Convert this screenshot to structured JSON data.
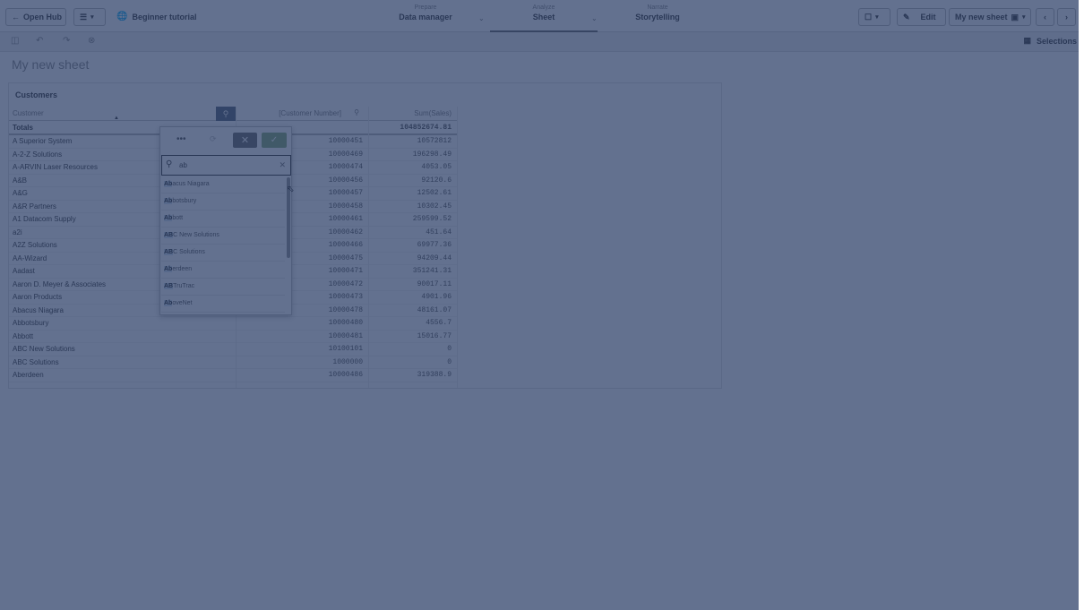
{
  "topbar": {
    "open_hub": "Open Hub",
    "app_name": "Beginner tutorial",
    "tabs": [
      {
        "small": "Prepare",
        "big": "Data manager"
      },
      {
        "small": "Analyze",
        "big": "Sheet"
      },
      {
        "small": "Narrate",
        "big": "Storytelling"
      }
    ],
    "edit_label": "Edit",
    "sheet_selector": "My new sheet"
  },
  "toolbar": {
    "selections_label": "Selections"
  },
  "sheet": {
    "title": "My new sheet"
  },
  "table": {
    "title": "Customers",
    "headers": [
      "Customer",
      "[Customer Number]",
      "Sum(Sales)"
    ],
    "totals": {
      "label": "Totals",
      "sum": "104852674.81"
    },
    "rows": [
      {
        "customer": "A Superior System",
        "number": "10000451",
        "sales": "10572812"
      },
      {
        "customer": "A-2-Z Solutions",
        "number": "10000469",
        "sales": "196298.49"
      },
      {
        "customer": "A-ARVIN Laser Resources",
        "number": "10000474",
        "sales": "4053.05"
      },
      {
        "customer": "A&B",
        "number": "10000456",
        "sales": "92120.6"
      },
      {
        "customer": "A&G",
        "number": "10000457",
        "sales": "12502.61"
      },
      {
        "customer": "A&R Partners",
        "number": "10000458",
        "sales": "10302.45"
      },
      {
        "customer": "A1 Datacom Supply",
        "number": "10000461",
        "sales": "259599.52"
      },
      {
        "customer": "a2i",
        "number": "10000462",
        "sales": "451.64"
      },
      {
        "customer": "A2Z Solutions",
        "number": "10000466",
        "sales": "69977.36"
      },
      {
        "customer": "AA-Wizard",
        "number": "10000475",
        "sales": "94209.44"
      },
      {
        "customer": "Aadast",
        "number": "10000471",
        "sales": "351241.31"
      },
      {
        "customer": "Aaron D. Meyer & Associates",
        "number": "10000472",
        "sales": "90017.11"
      },
      {
        "customer": "Aaron Products",
        "number": "10000473",
        "sales": "4901.96"
      },
      {
        "customer": "Abacus Niagara",
        "number": "10000478",
        "sales": "48161.07"
      },
      {
        "customer": "Abbotsbury",
        "number": "10000480",
        "sales": "4556.7"
      },
      {
        "customer": "Abbott",
        "number": "10000481",
        "sales": "15016.77"
      },
      {
        "customer": "ABC New Solutions",
        "number": "10100101",
        "sales": "0"
      },
      {
        "customer": "ABC Solutions",
        "number": "1000000",
        "sales": "0"
      },
      {
        "customer": "Aberdeen",
        "number": "10000486",
        "sales": "319388.9"
      }
    ]
  },
  "popup": {
    "more_label": "•••",
    "search_value": "ab",
    "items": [
      {
        "hl": "Ab",
        "rest": "acus Niagara"
      },
      {
        "hl": "Ab",
        "rest": "botsbury"
      },
      {
        "hl": "Ab",
        "rest": "bott"
      },
      {
        "hl": "AB",
        "rest": "C New Solutions"
      },
      {
        "hl": "AB",
        "rest": "C Solutions"
      },
      {
        "hl": "Ab",
        "rest": "erdeen"
      },
      {
        "hl": "AB",
        "rest": "TruTrac"
      },
      {
        "hl": "Ab",
        "rest": "oveNet"
      }
    ]
  },
  "colors": {
    "overlay": "#21355f",
    "confirm": "#8bb07d",
    "cancel": "#6e6e6e",
    "search_active": "#5c6a7d"
  }
}
